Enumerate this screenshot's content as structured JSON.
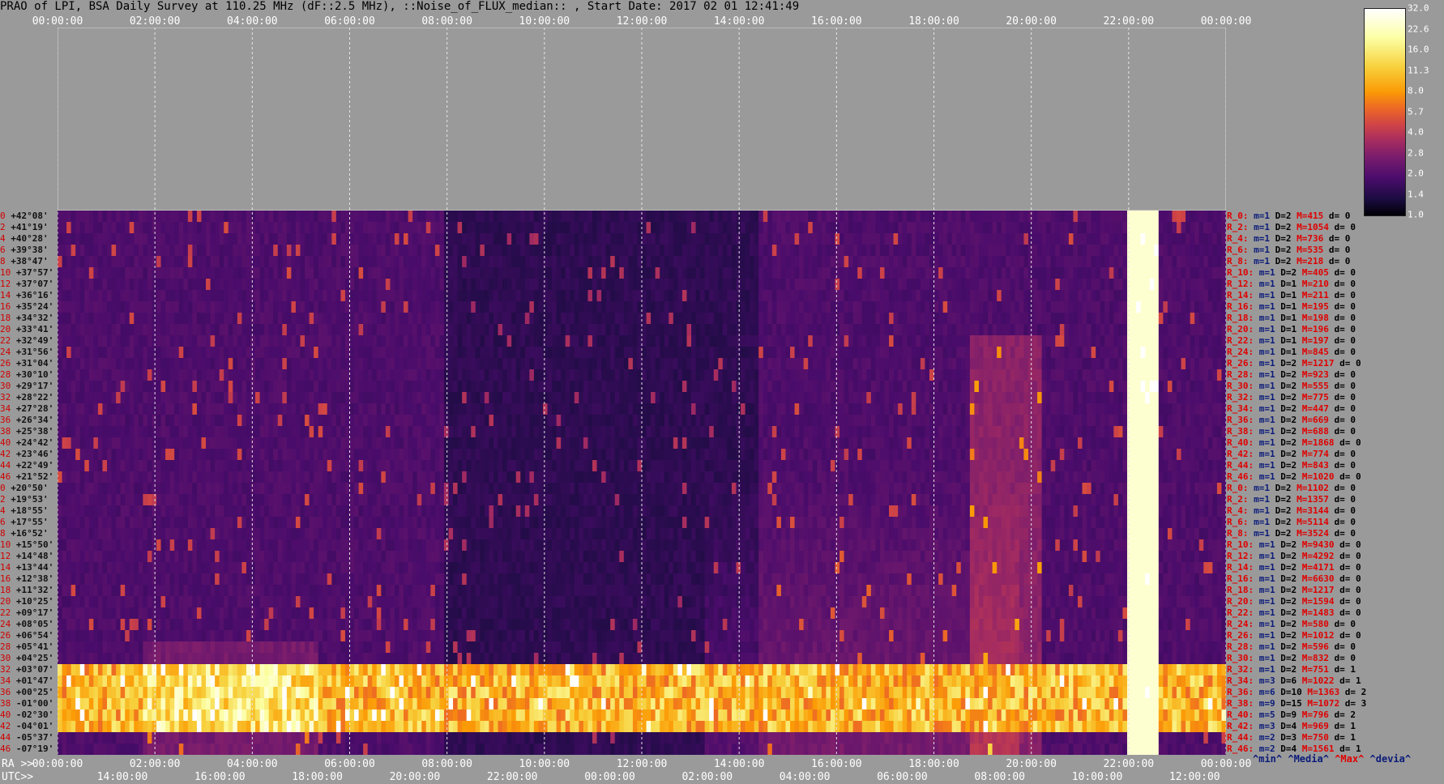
{
  "title": "PRAO of LPI, BSA Daily Survey at 110.25 MHz (dF::2.5 MHz), ::Noise_of_FLUX_median:: , Start Date: 2017 02 01 12:41:49",
  "top_axis": {
    "ticks": [
      "00:00:00",
      "02:00:00",
      "04:00:00",
      "06:00:00",
      "08:00:00",
      "10:00:00",
      "12:00:00",
      "14:00:00",
      "16:00:00",
      "18:00:00",
      "20:00:00",
      "22:00:00",
      "00:00:00"
    ]
  },
  "bottom_axis": {
    "ra_label": "RA >>",
    "utc_label": "UTC>>",
    "ra_ticks": [
      "00:00:00",
      "02:00:00",
      "04:00:00",
      "06:00:00",
      "08:00:00",
      "10:00:00",
      "12:00:00",
      "14:00:00",
      "16:00:00",
      "18:00:00",
      "20:00:00",
      "22:00:00",
      "00:00:00"
    ],
    "utc_ticks": [
      "14:00:00",
      "16:00:00",
      "18:00:00",
      "20:00:00",
      "22:00:00",
      "00:00:00",
      "02:00:00",
      "04:00:00",
      "06:00:00",
      "08:00:00",
      "10:00:00",
      "12:00:00"
    ]
  },
  "colorbar": {
    "ticks": [
      "32.0",
      "22.6",
      "16.0",
      "11.3",
      "8.0",
      "5.7",
      "4.0",
      "2.8",
      "2.0",
      "1.4",
      "1.0"
    ]
  },
  "stat_legend": {
    "min": "^min^",
    "media": "^Media^",
    "max": "^Max^",
    "devia": "^devia^"
  },
  "colors": {
    "background": "#9a9a9a",
    "max_label": "#e00000",
    "min_label": "#0b1b7a"
  },
  "chart_data": {
    "type": "heatmap",
    "title": "PRAO of LPI, BSA Daily Survey at 110.25 MHz (dF::2.5 MHz), ::Noise_of_FLUX_median:: , Start Date: 2017 02 01 12:41:49",
    "x_axis_top": "RA 00:00:00 → 00:00:00",
    "y_labels": [
      "+42°08'",
      "+41°19'",
      "+40°28'",
      "+39°38'",
      "+38°47'",
      "+37°57'",
      "+37°07'",
      "+36°16'",
      "+35°24'",
      "+34°32'",
      "+33°41'",
      "+32°49'",
      "+31°56'",
      "+31°04'",
      "+30°10'",
      "+29°17'",
      "+28°22'",
      "+27°28'",
      "+26°34'",
      "+25°38'",
      "+24°42'",
      "+23°46'",
      "+22°49'",
      "+21°52'",
      "+20°50'",
      "+19°53'",
      "+18°55'",
      "+17°55'",
      "+16°52'",
      "+15°50'",
      "+14°48'",
      "+13°44'",
      "+12°38'",
      "+11°32'",
      "+10°25'",
      "+09°17'",
      "+08°05'",
      "+06°54'",
      "+05°41'",
      "+04°25'",
      "+03°07'",
      "+01°47'",
      "+00°25'",
      "-01°00'",
      "-02°30'",
      "-04°01'",
      "-05°37'",
      "-07°19'"
    ],
    "y_indices": [
      "0",
      "2",
      "4",
      "6",
      "8",
      "10",
      "12",
      "14",
      "16",
      "18",
      "20",
      "22",
      "24",
      "26",
      "28",
      "30",
      "32",
      "34",
      "36",
      "38",
      "40",
      "42",
      "44",
      "46",
      "0",
      "2",
      "4",
      "6",
      "8",
      "10",
      "12",
      "14",
      "16",
      "18",
      "20",
      "22",
      "24",
      "26",
      "28",
      "30",
      "32",
      "34",
      "36",
      "38",
      "40",
      "42",
      "44",
      "46"
    ],
    "color_scale": [
      1.0,
      1.4,
      2.0,
      2.8,
      4.0,
      5.7,
      8.0,
      11.3,
      16.0,
      22.6,
      32.0
    ],
    "row_stats": [
      {
        "r": "R_0:",
        "m": "m=1",
        "d2": "D=2",
        "M": "M=415",
        "dv": "d= 0"
      },
      {
        "r": "R_2:",
        "m": "m=1",
        "d2": "D=2",
        "M": "M=1054",
        "dv": "d= 0"
      },
      {
        "r": "R_4:",
        "m": "m=1",
        "d2": "D=2",
        "M": "M=736",
        "dv": "d= 0"
      },
      {
        "r": "R_6:",
        "m": "m=1",
        "d2": "D=2",
        "M": "M=535",
        "dv": "d= 0"
      },
      {
        "r": "R_8:",
        "m": "m=1",
        "d2": "D=2",
        "M": "M=218",
        "dv": "d= 0"
      },
      {
        "r": "R_10:",
        "m": "m=1",
        "d2": "D=2",
        "M": "M=405",
        "dv": "d= 0"
      },
      {
        "r": "R_12:",
        "m": "m=1",
        "d2": "D=1",
        "M": "M=210",
        "dv": "d= 0"
      },
      {
        "r": "R_14:",
        "m": "m=1",
        "d2": "D=1",
        "M": "M=211",
        "dv": "d= 0"
      },
      {
        "r": "R_16:",
        "m": "m=1",
        "d2": "D=1",
        "M": "M=195",
        "dv": "d= 0"
      },
      {
        "r": "R_18:",
        "m": "m=1",
        "d2": "D=1",
        "M": "M=198",
        "dv": "d= 0"
      },
      {
        "r": "R_20:",
        "m": "m=1",
        "d2": "D=1",
        "M": "M=196",
        "dv": "d= 0"
      },
      {
        "r": "R_22:",
        "m": "m=1",
        "d2": "D=1",
        "M": "M=197",
        "dv": "d= 0"
      },
      {
        "r": "R_24:",
        "m": "m=1",
        "d2": "D=1",
        "M": "M=845",
        "dv": "d= 0"
      },
      {
        "r": "R_26:",
        "m": "m=1",
        "d2": "D=2",
        "M": "M=1217",
        "dv": "d= 0"
      },
      {
        "r": "R_28:",
        "m": "m=1",
        "d2": "D=2",
        "M": "M=923",
        "dv": "d= 0"
      },
      {
        "r": "R_30:",
        "m": "m=1",
        "d2": "D=2",
        "M": "M=555",
        "dv": "d= 0"
      },
      {
        "r": "R_32:",
        "m": "m=1",
        "d2": "D=2",
        "M": "M=775",
        "dv": "d= 0"
      },
      {
        "r": "R_34:",
        "m": "m=1",
        "d2": "D=2",
        "M": "M=447",
        "dv": "d= 0"
      },
      {
        "r": "R_36:",
        "m": "m=1",
        "d2": "D=2",
        "M": "M=669",
        "dv": "d= 0"
      },
      {
        "r": "R_38:",
        "m": "m=1",
        "d2": "D=2",
        "M": "M=688",
        "dv": "d= 0"
      },
      {
        "r": "R_40:",
        "m": "m=1",
        "d2": "D=2",
        "M": "M=1868",
        "dv": "d= 0"
      },
      {
        "r": "R_42:",
        "m": "m=1",
        "d2": "D=2",
        "M": "M=774",
        "dv": "d= 0"
      },
      {
        "r": "R_44:",
        "m": "m=1",
        "d2": "D=2",
        "M": "M=843",
        "dv": "d= 0"
      },
      {
        "r": "R_46:",
        "m": "m=1",
        "d2": "D=2",
        "M": "M=1020",
        "dv": "d= 0"
      },
      {
        "r": "R_0:",
        "m": "m=1",
        "d2": "D=2",
        "M": "M=1102",
        "dv": "d= 0"
      },
      {
        "r": "R_2:",
        "m": "m=1",
        "d2": "D=2",
        "M": "M=1357",
        "dv": "d= 0"
      },
      {
        "r": "R_4:",
        "m": "m=1",
        "d2": "D=2",
        "M": "M=3144",
        "dv": "d= 0"
      },
      {
        "r": "R_6:",
        "m": "m=1",
        "d2": "D=2",
        "M": "M=5114",
        "dv": "d= 0"
      },
      {
        "r": "R_8:",
        "m": "m=1",
        "d2": "D=2",
        "M": "M=3524",
        "dv": "d= 0"
      },
      {
        "r": "R_10:",
        "m": "m=1",
        "d2": "D=2",
        "M": "M=9430",
        "dv": "d= 0"
      },
      {
        "r": "R_12:",
        "m": "m=1",
        "d2": "D=2",
        "M": "M=4292",
        "dv": "d= 0"
      },
      {
        "r": "R_14:",
        "m": "m=1",
        "d2": "D=2",
        "M": "M=4171",
        "dv": "d= 0"
      },
      {
        "r": "R_16:",
        "m": "m=1",
        "d2": "D=2",
        "M": "M=6630",
        "dv": "d= 0"
      },
      {
        "r": "R_18:",
        "m": "m=1",
        "d2": "D=2",
        "M": "M=1217",
        "dv": "d= 0"
      },
      {
        "r": "R_20:",
        "m": "m=1",
        "d2": "D=2",
        "M": "M=1594",
        "dv": "d= 0"
      },
      {
        "r": "R_22:",
        "m": "m=1",
        "d2": "D=2",
        "M": "M=1483",
        "dv": "d= 0"
      },
      {
        "r": "R_24:",
        "m": "m=1",
        "d2": "D=2",
        "M": "M=580",
        "dv": "d= 0"
      },
      {
        "r": "R_26:",
        "m": "m=1",
        "d2": "D=2",
        "M": "M=1012",
        "dv": "d= 0"
      },
      {
        "r": "R_28:",
        "m": "m=1",
        "d2": "D=2",
        "M": "M=596",
        "dv": "d= 0"
      },
      {
        "r": "R_30:",
        "m": "m=1",
        "d2": "D=2",
        "M": "M=832",
        "dv": "d= 0"
      },
      {
        "r": "R_32:",
        "m": "m=1",
        "d2": "D=2",
        "M": "M=751",
        "dv": "d= 1"
      },
      {
        "r": "R_34:",
        "m": "m=3",
        "d2": "D=6",
        "M": "M=1022",
        "dv": "d= 1"
      },
      {
        "r": "R_36:",
        "m": "m=6",
        "d2": "D=10",
        "M": "M=1363",
        "dv": "d= 2"
      },
      {
        "r": "R_38:",
        "m": "m=9",
        "d2": "D=15",
        "M": "M=1072",
        "dv": "d= 3"
      },
      {
        "r": "R_40:",
        "m": "m=5",
        "d2": "D=9",
        "M": "M=796",
        "dv": "d= 2"
      },
      {
        "r": "R_42:",
        "m": "m=3",
        "d2": "D=4",
        "M": "M=969",
        "dv": "d= 1"
      },
      {
        "r": "R_44:",
        "m": "m=2",
        "d2": "D=3",
        "M": "M=750",
        "dv": "d= 1"
      },
      {
        "r": "R_46:",
        "m": "m=2",
        "d2": "D=4",
        "M": "M=1561",
        "dv": "d= 1"
      }
    ],
    "grid": true
  }
}
